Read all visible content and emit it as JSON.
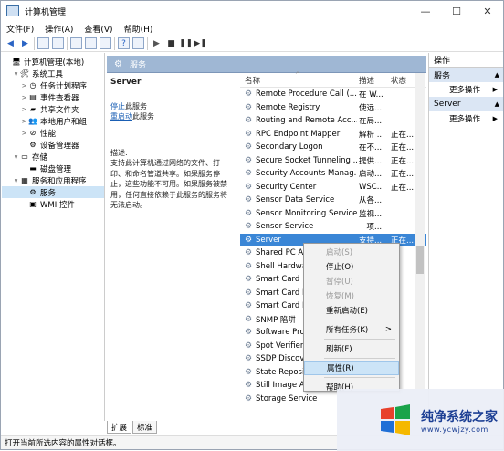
{
  "window": {
    "title": "计算机管理",
    "min": "—",
    "max": "☐",
    "close": "✕"
  },
  "menu": [
    "文件(F)",
    "操作(A)",
    "查看(V)",
    "帮助(H)"
  ],
  "tree": [
    {
      "label": "计算机管理(本地)",
      "arrow": "",
      "icon": "computer-icon",
      "glyph": "🖥",
      "indent": 0
    },
    {
      "label": "系统工具",
      "arrow": "∨",
      "icon": "tools-icon",
      "glyph": "🛠",
      "indent": 1
    },
    {
      "label": "任务计划程序",
      "arrow": ">",
      "icon": "clock-icon",
      "glyph": "◷",
      "indent": 2
    },
    {
      "label": "事件查看器",
      "arrow": ">",
      "icon": "event-viewer-icon",
      "glyph": "▤",
      "indent": 2
    },
    {
      "label": "共享文件夹",
      "arrow": ">",
      "icon": "shared-folder-icon",
      "glyph": "▰",
      "indent": 2
    },
    {
      "label": "本地用户和组",
      "arrow": ">",
      "icon": "users-icon",
      "glyph": "👥",
      "indent": 2
    },
    {
      "label": "性能",
      "arrow": ">",
      "icon": "performance-icon",
      "glyph": "⊘",
      "indent": 2
    },
    {
      "label": "设备管理器",
      "arrow": "",
      "icon": "device-manager-icon",
      "glyph": "⚙",
      "indent": 2
    },
    {
      "label": "存储",
      "arrow": "∨",
      "icon": "storage-icon",
      "glyph": "▭",
      "indent": 1
    },
    {
      "label": "磁盘管理",
      "arrow": "",
      "icon": "disk-icon",
      "glyph": "▬",
      "indent": 2
    },
    {
      "label": "服务和应用程序",
      "arrow": "∨",
      "icon": "services-apps-icon",
      "glyph": "▦",
      "indent": 1
    },
    {
      "label": "服务",
      "arrow": "",
      "icon": "services-icon",
      "glyph": "⚙",
      "indent": 2,
      "selected": true
    },
    {
      "label": "WMI 控件",
      "arrow": "",
      "icon": "wmi-icon",
      "glyph": "▣",
      "indent": 2
    }
  ],
  "middle": {
    "header": "服务",
    "service_name": "Server",
    "stop_link": "停止",
    "stop_suffix": "此服务",
    "restart_link": "重启动",
    "restart_suffix": "此服务",
    "desc_label": "描述:",
    "desc_text": "支持此计算机通过网络的文件、打印、和命名管道共享。如果服务停止，这些功能不可用。如果服务被禁用，任何直接依赖于此服务的服务将无法启动。"
  },
  "columns": {
    "name": "名称",
    "desc": "描述",
    "status": "状态",
    "sort_arrow": "^"
  },
  "services": [
    {
      "name": "Remote Procedure Call (...",
      "desc": "在 W...",
      "status": ""
    },
    {
      "name": "Remote Registry",
      "desc": "使远...",
      "status": ""
    },
    {
      "name": "Routing and Remote Acc...",
      "desc": "在局...",
      "status": ""
    },
    {
      "name": "RPC Endpoint Mapper",
      "desc": "解析 ...",
      "status": "正在..."
    },
    {
      "name": "Secondary Logon",
      "desc": "在不...",
      "status": "正在..."
    },
    {
      "name": "Secure Socket Tunneling ...",
      "desc": "提供...",
      "status": "正在..."
    },
    {
      "name": "Security Accounts Manag...",
      "desc": "启动...",
      "status": "正在..."
    },
    {
      "name": "Security Center",
      "desc": "WSC...",
      "status": "正在..."
    },
    {
      "name": "Sensor Data Service",
      "desc": "从各...",
      "status": ""
    },
    {
      "name": "Sensor Monitoring Service",
      "desc": "监视...",
      "status": ""
    },
    {
      "name": "Sensor Service",
      "desc": "一项...",
      "status": ""
    },
    {
      "name": "Server",
      "desc": "支持...",
      "status": "正在...",
      "selected": true
    },
    {
      "name": "Shared PC Ac",
      "desc": "",
      "status": ""
    },
    {
      "name": "Shell Hardwa",
      "desc": "",
      "status": ""
    },
    {
      "name": "Smart Card",
      "desc": "",
      "status": ""
    },
    {
      "name": "Smart Card D",
      "desc": "",
      "status": ""
    },
    {
      "name": "Smart Card R",
      "desc": "",
      "status": ""
    },
    {
      "name": "SNMP 陷阱",
      "desc": "",
      "status": ""
    },
    {
      "name": "Software Pro",
      "desc": "",
      "status": ""
    },
    {
      "name": "Spot Verifier",
      "desc": "",
      "status": ""
    },
    {
      "name": "SSDP Discove",
      "desc": "",
      "status": ""
    },
    {
      "name": "State Reposit",
      "desc": "",
      "status": ""
    },
    {
      "name": "Still Image Acqui",
      "desc": "",
      "status": ""
    },
    {
      "name": "Storage Service",
      "desc": "",
      "status": ""
    }
  ],
  "context_menu": {
    "start": "启动(S)",
    "stop": "停止(O)",
    "pause": "暂停(U)",
    "resume": "恢复(M)",
    "restart": "重新启动(E)",
    "all_tasks": "所有任务(K)",
    "all_tasks_arrow": ">",
    "refresh": "刷新(F)",
    "properties": "属性(R)",
    "help": "帮助(H)"
  },
  "tabs": [
    "扩展",
    "标准"
  ],
  "actions": {
    "title": "操作",
    "section1": "服务",
    "more1": "更多操作",
    "section2": "Server",
    "more2": "更多操作",
    "arrow_up": "▲",
    "arrow_right": "▶"
  },
  "status_text": "打开当前所选内容的属性对话框。",
  "watermark": {
    "title": "纯净系统之家",
    "url": "www.ycwjzy.com"
  }
}
